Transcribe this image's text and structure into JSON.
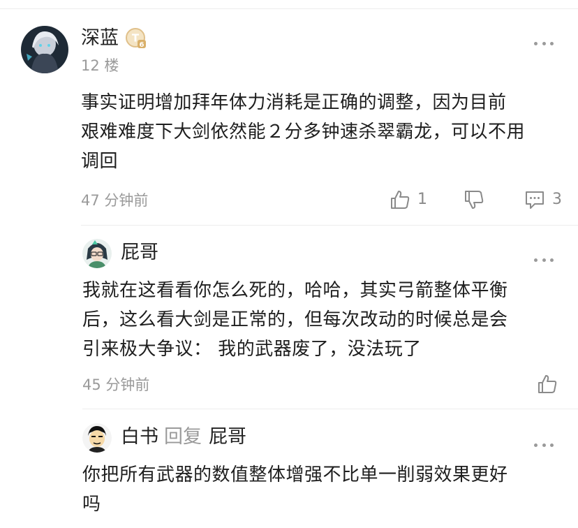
{
  "comments": [
    {
      "username": "深蓝",
      "level_badge": "T6",
      "floor": "12 楼",
      "text_lines": [
        "事实证明增加拜年体力消耗是正确的调整，因为目前",
        "艰难难度下大剑依然能２分多钟速杀翠霸龙，可以不用",
        "调回"
      ],
      "time": "47 分钟前",
      "likes": "1",
      "replies": "3",
      "icons": [
        "like-icon",
        "dislike-icon",
        "comment-icon",
        "more-icon"
      ]
    },
    {
      "username": "屁哥",
      "text_lines": [
        "我就在这看看你怎么死的，哈哈，其实弓箭整体平衡",
        "后，这么看大剑是正常的，但每次改动的时候总是会",
        "引来极大争议：  我的武器废了，没法玩了"
      ],
      "time": "45 分钟前",
      "icons": [
        "like-icon",
        "more-icon"
      ]
    },
    {
      "username": "白书",
      "reply_label": "回复",
      "reply_to": "屁哥",
      "text_lines": [
        "你把所有武器的数值整体增强不比单一削弱效果更好",
        "吗"
      ],
      "icons": [
        "more-icon"
      ]
    }
  ],
  "colors": {
    "text": "#1e1e1e",
    "secondary": "#9a9a9a",
    "badge_gold": "#d9b06a",
    "divider": "#ededed"
  }
}
